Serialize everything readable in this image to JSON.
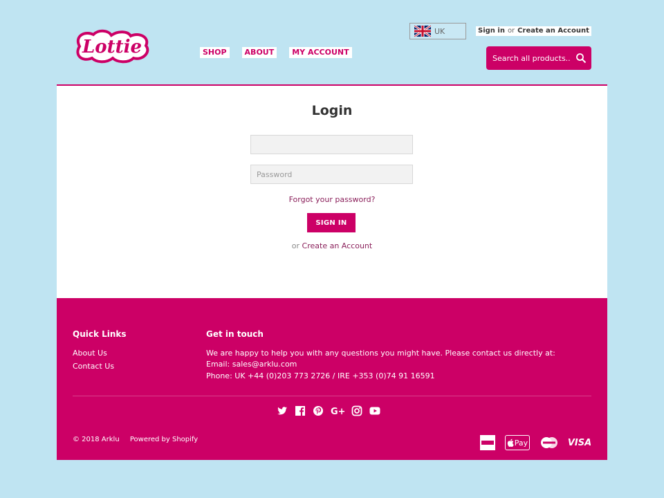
{
  "header": {
    "logo_text": "Lottie",
    "nav": [
      {
        "label": "SHOP"
      },
      {
        "label": "ABOUT"
      },
      {
        "label": "MY ACCOUNT"
      }
    ],
    "country": {
      "label": "UK",
      "flag_icon": "uk-flag-icon"
    },
    "account": {
      "sign_in": "Sign in",
      "or": "or",
      "create": "Create an Account"
    },
    "search": {
      "placeholder": "Search all products...",
      "icon": "search-icon"
    }
  },
  "login": {
    "title": "Login",
    "email_placeholder": "",
    "password_placeholder": "Password",
    "forgot": "Forgot your password?",
    "submit": "SIGN IN",
    "or": "or",
    "create": "Create an Account"
  },
  "footer": {
    "quick_links": {
      "title": "Quick Links",
      "items": [
        {
          "label": "About Us"
        },
        {
          "label": "Contact Us"
        }
      ]
    },
    "get_in_touch": {
      "title": "Get in touch",
      "line1": "We are happy to help you with any questions you might have. Please contact us directly at:",
      "line2": "Email: sales@arklu.com",
      "line3": "Phone: UK +44 (0)203 773 2726 / IRE +353 (0)74 91 16591"
    },
    "social_icons": [
      "twitter-icon",
      "facebook-icon",
      "pinterest-icon",
      "google-plus-icon",
      "instagram-icon",
      "youtube-icon"
    ],
    "copyright": "© 2018 Arklu",
    "powered": "Powered by Shopify",
    "payments": {
      "apple": "Pay",
      "visa": "VISA"
    }
  },
  "colors": {
    "brand": "#cc0066",
    "background": "#bfe4f2"
  }
}
